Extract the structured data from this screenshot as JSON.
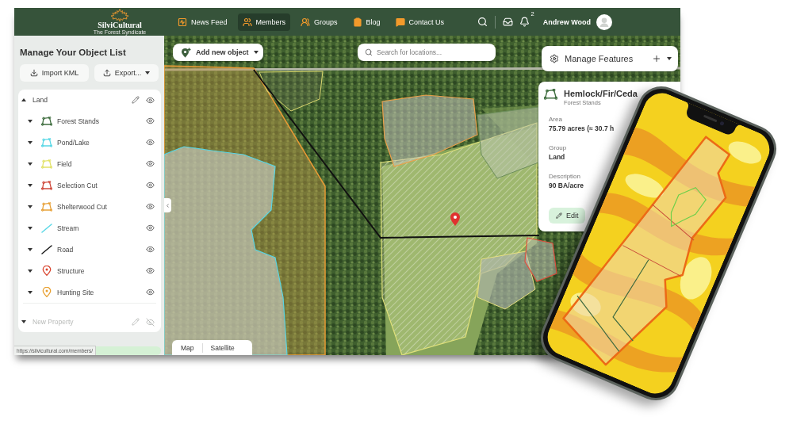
{
  "header": {
    "logo": {
      "name": "SilviCultural",
      "tagline": "The Forest Syndicate"
    },
    "nav": [
      {
        "label": "News Feed",
        "selected": false
      },
      {
        "label": "Members",
        "selected": true
      },
      {
        "label": "Groups",
        "selected": false
      },
      {
        "label": "Blog",
        "selected": false
      },
      {
        "label": "Contact Us",
        "selected": false
      }
    ],
    "notification_count": "2",
    "user_name": "Andrew Wood"
  },
  "sidebar": {
    "title": "Manage Your Object List",
    "buttons": [
      {
        "label": "Import KML",
        "kind": "import"
      },
      {
        "label": "Export...",
        "kind": "export"
      }
    ],
    "groups": [
      {
        "name": "Land",
        "expanded": true,
        "visible": true,
        "disabled": false,
        "children": [
          {
            "name": "Forest Stands",
            "kind": "polygon",
            "color": "#3f6e3f",
            "expanded": false,
            "visible": true
          },
          {
            "name": "Pond/Lake",
            "kind": "polygon",
            "color": "#5ad8e6",
            "expanded": false,
            "visible": true
          },
          {
            "name": "Field",
            "kind": "polygon",
            "color": "#e3e36a",
            "expanded": false,
            "visible": true
          },
          {
            "name": "Selection Cut",
            "kind": "polygon",
            "color": "#d04a3c",
            "expanded": false,
            "visible": true
          },
          {
            "name": "Shelterwood Cut",
            "kind": "polygon",
            "color": "#e8a23a",
            "expanded": false,
            "visible": true
          },
          {
            "name": "Stream",
            "kind": "line",
            "color": "#5ad8e6",
            "expanded": false,
            "visible": true
          },
          {
            "name": "Road",
            "kind": "line",
            "color": "#1a1a1a",
            "expanded": false,
            "visible": true
          },
          {
            "name": "Structure",
            "kind": "pin",
            "color": "#d9452f",
            "expanded": false,
            "visible": true
          },
          {
            "name": "Hunting Site",
            "kind": "pin",
            "color": "#e8a030",
            "expanded": false,
            "visible": true
          }
        ]
      },
      {
        "name": "New Property",
        "expanded": false,
        "visible": false,
        "disabled": true
      }
    ]
  },
  "map": {
    "add_button": "Add new object",
    "search": {
      "placeholder": "Search for locations..."
    },
    "manage_features": "Manage Features",
    "feature_card": {
      "title": "Hemlock/Fir/Ceda",
      "subtitle": "Forest Stands",
      "fields": [
        {
          "label": "Area",
          "value": "75.79 acres (≈ 30.7 h"
        },
        {
          "label": "Group",
          "value": "Land"
        },
        {
          "label": "Description",
          "value": "90 BA/acre"
        }
      ],
      "edit_button": "Edit"
    },
    "map_types": [
      "Map",
      "Satellite"
    ]
  },
  "link_preview": "https://silvicultural.com/members/"
}
